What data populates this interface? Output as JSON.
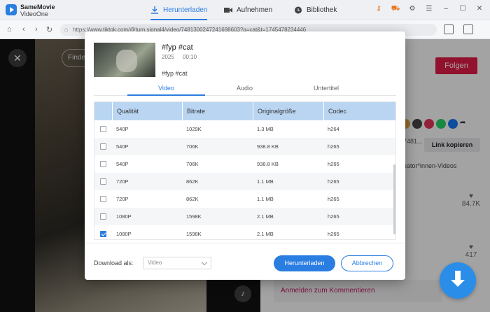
{
  "app": {
    "name": "SameMovie",
    "sub": "VideoOne"
  },
  "nav": [
    {
      "label": "Herunterladen",
      "icon": "download-icon",
      "active": true
    },
    {
      "label": "Aufnehmen",
      "icon": "record-icon",
      "active": false
    },
    {
      "label": "Bibliothek",
      "icon": "library-icon",
      "active": false
    }
  ],
  "address": {
    "url": "https://www.tiktok.com/@turn.signal4/video/7481300247241698603?q=cat&t=1745478234446"
  },
  "background": {
    "find_label": "Finde",
    "follow_label": "Folgen",
    "link_partial": "7481...",
    "copy_link_label": "Link kopieren",
    "creator_videos": "eator*innen-Videos",
    "likes": "84.7K",
    "comments": "417",
    "login_comment": "Anmelden zum Kommentieren"
  },
  "video": {
    "title": "#fyp #cat",
    "year": "2025",
    "duration": "00:10",
    "description": "#fyp #cat"
  },
  "tabs": [
    {
      "label": "Video",
      "active": true
    },
    {
      "label": "Audio",
      "active": false
    },
    {
      "label": "Untertitel",
      "active": false
    }
  ],
  "table": {
    "headers": [
      "Qualität",
      "Bitrate",
      "Originalgröße",
      "Codec"
    ],
    "rows": [
      {
        "checked": false,
        "quality": "540P",
        "bitrate": "1029K",
        "size": "1.3 MB",
        "codec": "h264"
      },
      {
        "checked": false,
        "quality": "540P",
        "bitrate": "706K",
        "size": "938.8 KB",
        "codec": "h265"
      },
      {
        "checked": false,
        "quality": "540P",
        "bitrate": "706K",
        "size": "938.8 KB",
        "codec": "h265"
      },
      {
        "checked": false,
        "quality": "720P",
        "bitrate": "862K",
        "size": "1.1 MB",
        "codec": "h265"
      },
      {
        "checked": false,
        "quality": "720P",
        "bitrate": "862K",
        "size": "1.1 MB",
        "codec": "h265"
      },
      {
        "checked": false,
        "quality": "1080P",
        "bitrate": "1598K",
        "size": "2.1 MB",
        "codec": "h265"
      },
      {
        "checked": true,
        "quality": "1080P",
        "bitrate": "1598K",
        "size": "2.1 MB",
        "codec": "h265"
      }
    ]
  },
  "footer": {
    "download_as_label": "Download als:",
    "download_as_value": "Video",
    "primary_label": "Herunterladen",
    "secondary_label": "Abbrechen"
  }
}
